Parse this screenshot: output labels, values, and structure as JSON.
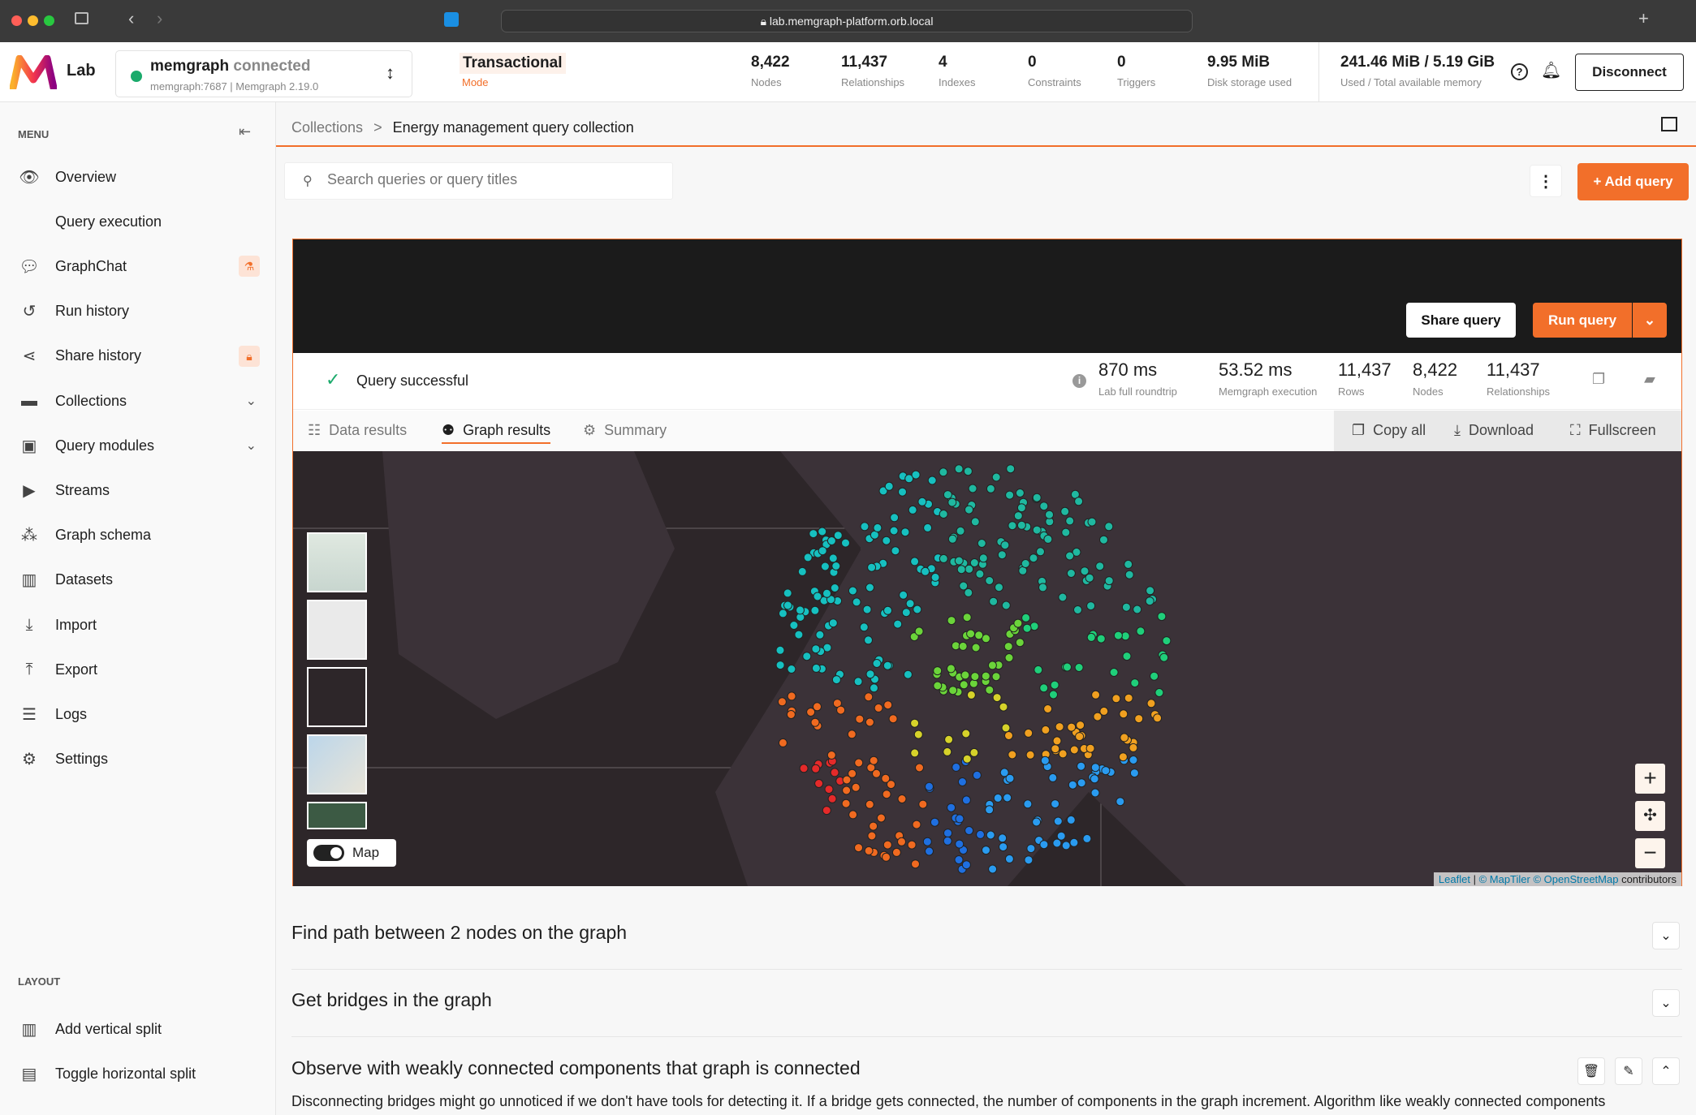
{
  "browser": {
    "url": "lab.memgraph-platform.orb.local"
  },
  "header": {
    "app_name": "Lab",
    "instance": "memgraph",
    "status": "connected",
    "host": "memgraph:7687",
    "version": "Memgraph 2.19.0",
    "mode_value": "Transactional",
    "mode_label": "Mode",
    "stats": [
      {
        "value": "8,422",
        "label": "Nodes"
      },
      {
        "value": "11,437",
        "label": "Relationships"
      },
      {
        "value": "4",
        "label": "Indexes"
      },
      {
        "value": "0",
        "label": "Constraints"
      },
      {
        "value": "0",
        "label": "Triggers"
      },
      {
        "value": "9.95 MiB",
        "label": "Disk storage used"
      }
    ],
    "memory": {
      "value": "241.46 MiB / 5.19 GiB",
      "label": "Used / Total available memory"
    },
    "disconnect": "Disconnect"
  },
  "sidebar": {
    "menu_label": "MENU",
    "items": [
      {
        "label": "Overview",
        "icon": "eye-icon"
      },
      {
        "label": "Query execution",
        "icon": "code-icon"
      },
      {
        "label": "GraphChat",
        "icon": "chat-icon",
        "badge": "flask-icon"
      },
      {
        "label": "Run history",
        "icon": "history-icon"
      },
      {
        "label": "Share history",
        "icon": "share-icon",
        "badge": "lock-icon"
      },
      {
        "label": "Collections",
        "icon": "folder-icon"
      },
      {
        "label": "Query modules",
        "icon": "module-icon"
      },
      {
        "label": "Streams",
        "icon": "play-icon"
      },
      {
        "label": "Graph schema",
        "icon": "schema-icon"
      },
      {
        "label": "Datasets",
        "icon": "books-icon"
      },
      {
        "label": "Import",
        "icon": "import-icon"
      },
      {
        "label": "Export",
        "icon": "export-icon"
      },
      {
        "label": "Logs",
        "icon": "list-icon"
      },
      {
        "label": "Settings",
        "icon": "gear-icon"
      }
    ],
    "layout_label": "LAYOUT",
    "layout_items": [
      {
        "label": "Add vertical split"
      },
      {
        "label": "Toggle horizontal split"
      }
    ]
  },
  "main": {
    "breadcrumb": [
      "Collections",
      "Energy management query collection"
    ],
    "search_placeholder": "Search queries or query titles",
    "add_query": "+ Add query",
    "share_query": "Share query",
    "run_query": "Run query",
    "status": "Query successful",
    "metrics": [
      {
        "value": "870 ms",
        "label": "Lab full roundtrip"
      },
      {
        "value": "53.52 ms",
        "label": "Memgraph execution"
      },
      {
        "value": "11,437",
        "label": "Rows"
      },
      {
        "value": "8,422",
        "label": "Nodes"
      },
      {
        "value": "11,437",
        "label": "Relationships"
      }
    ],
    "tabs": [
      "Data results",
      "Graph results",
      "Summary"
    ],
    "active_tab": "Graph results",
    "actions": [
      "Copy all",
      "Download",
      "Fullscreen"
    ],
    "map_toggle": "Map",
    "attribution": {
      "leaflet": "Leaflet",
      "maptiler": "© MapTiler",
      "osm": "© OpenStreetMap",
      "rest": "contributors"
    },
    "accordion": [
      {
        "title": "Find path between 2 nodes on the graph"
      },
      {
        "title": "Get bridges in the graph"
      },
      {
        "title": "Observe with weakly connected components that graph is connected",
        "description": "Disconnecting bridges might go unnoticed if we don't have tools for detecting it. If a bridge gets connected, the number of components in the graph increment. Algorithm like weakly connected components"
      }
    ]
  },
  "colors": {
    "accent": "#f26f2a",
    "success": "#1aaa6b",
    "map_bg": "#2d2629"
  }
}
